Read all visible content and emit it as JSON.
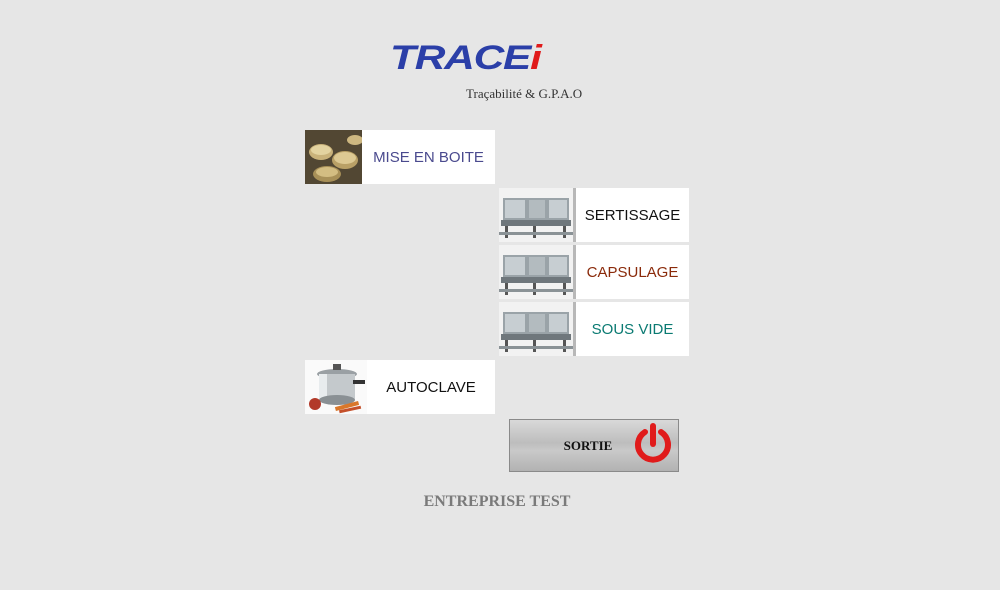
{
  "header": {
    "logo_main": "TRACE",
    "logo_accent": "i",
    "tagline": "Traçabilité & G.P.A.O"
  },
  "menu": {
    "mise_en_boite": {
      "label": "MISE EN BOITE",
      "color": "#4a4a8e"
    },
    "sertissage": {
      "label": "SERTISSAGE",
      "color": "#111111"
    },
    "capsulage": {
      "label": "CAPSULAGE",
      "color": "#8a2a0a"
    },
    "sous_vide": {
      "label": "SOUS VIDE",
      "color": "#0a7a72"
    },
    "autoclave": {
      "label": "AUTOCLAVE",
      "color": "#111111"
    }
  },
  "exit": {
    "label": "SORTIE",
    "icon": "power-icon",
    "icon_color": "#e01b1b"
  },
  "footer": {
    "company": "ENTREPRISE TEST"
  },
  "colors": {
    "background": "#e6e6e6",
    "logo_blue": "#2b3fa8",
    "logo_red": "#e01b1b"
  }
}
